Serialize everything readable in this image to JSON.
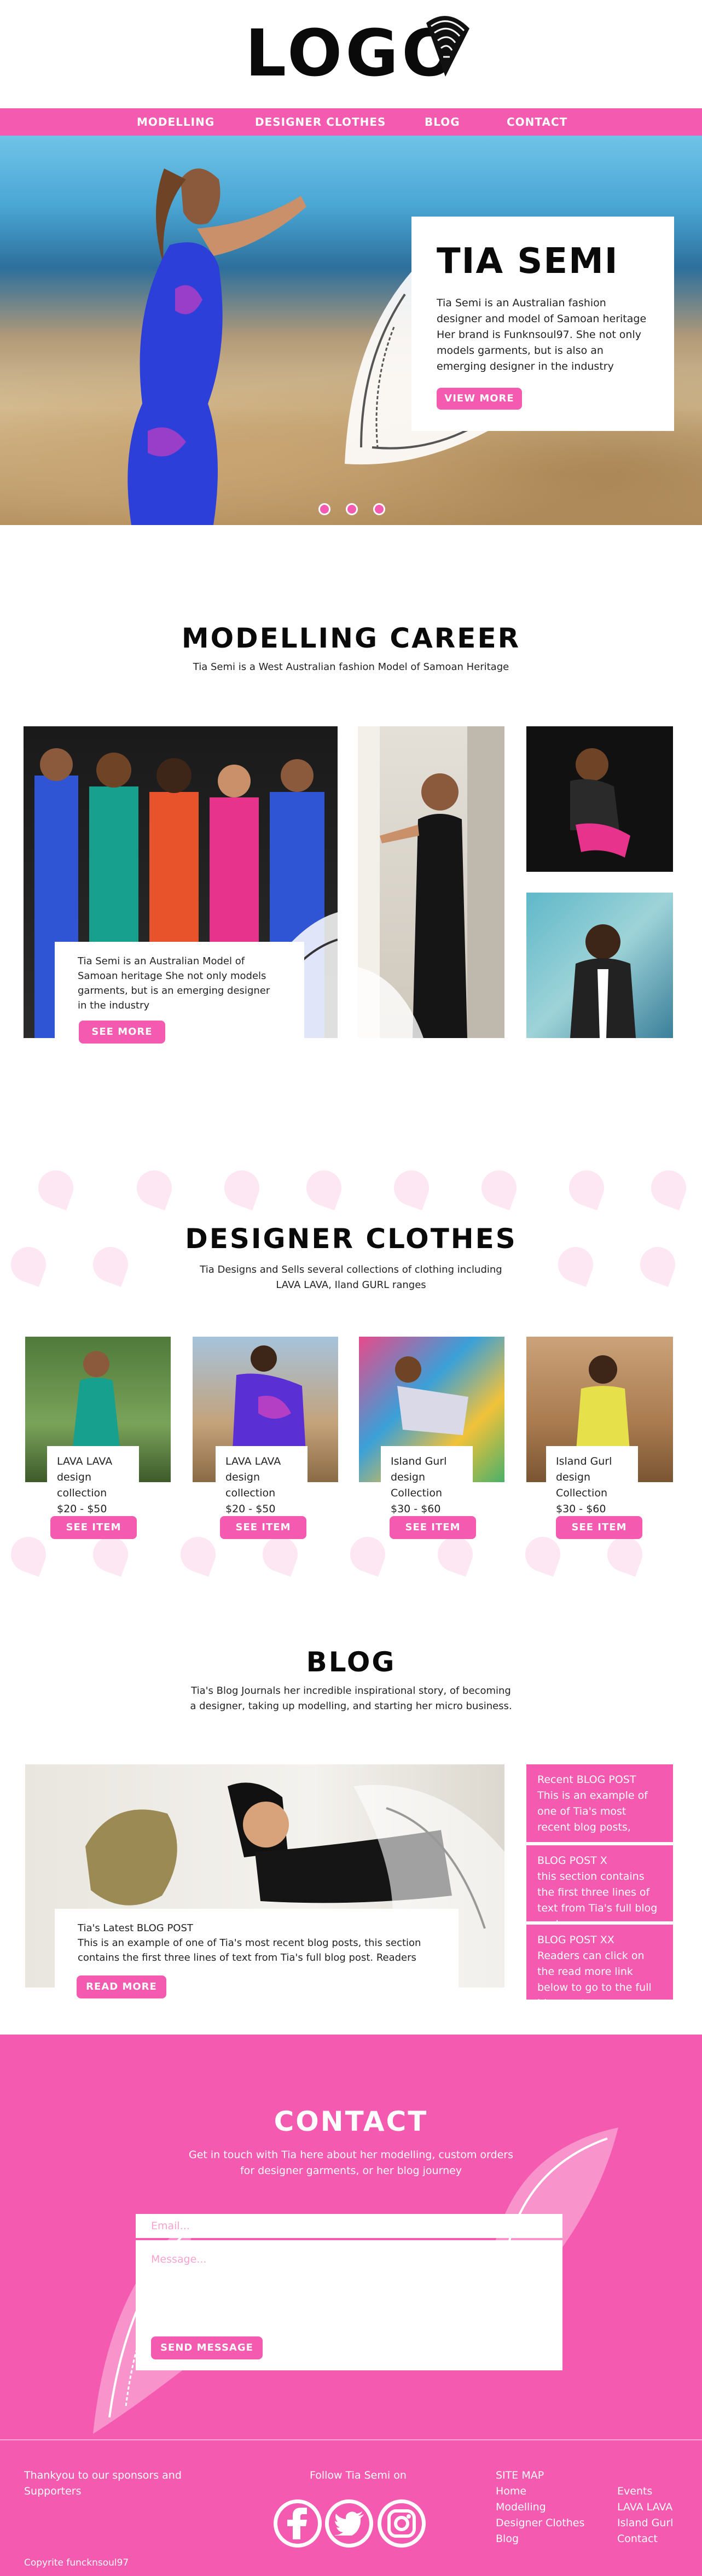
{
  "brand": {
    "logo_text": "LOGO",
    "accent": "#f45ab0"
  },
  "nav": {
    "items": [
      {
        "label": "MODELLING"
      },
      {
        "label": "DESIGNER CLOTHES"
      },
      {
        "label": "BLOG"
      },
      {
        "label": "CONTACT"
      }
    ]
  },
  "hero": {
    "title": "TIA SEMI",
    "text": "Tia Semi is an Australian fashion designer and model of Samoan heritage Her brand is Funknsoul97. She not only models garments, but is also an emerging designer in the industry",
    "button": "VIEW MORE",
    "carousel": {
      "slides": 3,
      "active": 1
    }
  },
  "modelling": {
    "title": "MODELLING CAREER",
    "subtitle": "Tia Semi is a West Australian  fashion Model of Samoan Heritage",
    "card_text": "Tia Semi is an Australian Model of Samoan heritage She not only models garments, but is an emerging designer in the industry",
    "button": "SEE MORE"
  },
  "designer": {
    "title": "DESIGNER CLOTHES",
    "subtitle_line1": "Tia Designs and Sells several collections of clothing including",
    "subtitle_line2": "LAVA LAVA, Iland GURL ranges",
    "items": [
      {
        "name_line1": "LAVA LAVA",
        "name_line2": "design collection",
        "price": "$20 - $50",
        "button": "SEE ITEM"
      },
      {
        "name_line1": "LAVA LAVA",
        "name_line2": "design collection",
        "price": "$20 - $50",
        "button": "SEE ITEM"
      },
      {
        "name_line1": "Island Gurl",
        "name_line2": "design Collection",
        "price": "$30 - $60",
        "button": "SEE ITEM"
      },
      {
        "name_line1": "Island Gurl",
        "name_line2": "design Collection",
        "price": "$30 - $60",
        "button": "SEE ITEM"
      }
    ]
  },
  "blog": {
    "title": "BLOG",
    "subtitle_line1": "Tia's Blog Journals her incredible inspirational story, of becoming",
    "subtitle_line2": "a designer, taking up modelling, and starting her micro business.",
    "latest_title": "Tia's Latest BLOG POST",
    "latest_text": "This is an example of one of Tia's most recent blog posts, this section contains the first three lines of text from Tia's full blog post. Readers can",
    "button": "READ MORE",
    "side_posts": [
      {
        "title": "Recent BLOG POST",
        "text": "This is an example of one of Tia's most recent blog posts,"
      },
      {
        "title": "BLOG POST  X",
        "text": "this section contains the first three lines of text from Tia's full blog post"
      },
      {
        "title": "BLOG POST XX",
        "text": "Readers can click on the read more link below to go to the full blog post"
      }
    ]
  },
  "contact": {
    "title": "CONTACT",
    "subtitle_line1": "Get in touch with Tia here about her modelling, custom orders",
    "subtitle_line2": "for designer garments, or her blog journey",
    "email_placeholder": "Email...",
    "message_placeholder": "Message...",
    "button": "SEND MESSAGE"
  },
  "footer": {
    "sponsors_line1": "Thankyou to our sponsors and",
    "sponsors_line2": "Supporters",
    "follow": "Follow Tia Semi on",
    "copyright": "Copyrite funcknsoul97",
    "sitemap_title": "SITE MAP",
    "links_col1": [
      "Home",
      "Modelling",
      "Designer Clothes",
      "Blog"
    ],
    "links_col2": [
      "Events",
      "LAVA LAVA",
      "Island Gurl",
      "Contact"
    ],
    "social_icons": [
      "facebook-icon",
      "twitter-icon",
      "instagram-icon"
    ]
  }
}
